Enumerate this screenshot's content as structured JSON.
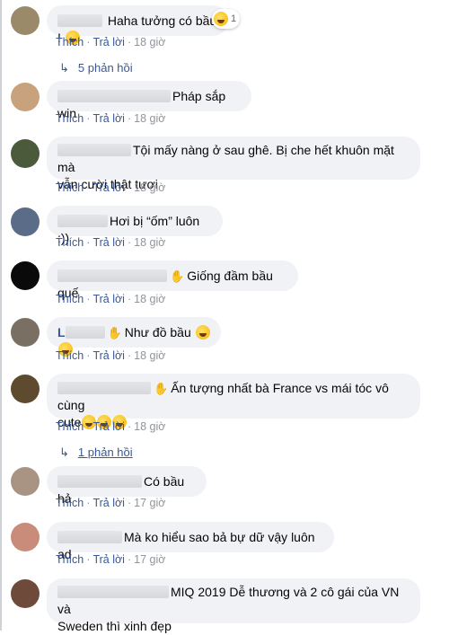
{
  "actions": {
    "like": "Thích",
    "reply": "Trả lời",
    "sep": "·"
  },
  "comments": [
    {
      "text": "Haha tưởng có bầu ! ",
      "time": "18 giờ",
      "reaction_count": "1",
      "replies": "5 phản hồi",
      "avatar_color": "#9b8a6a"
    },
    {
      "text": "Pháp sắp win",
      "time": "18 giờ",
      "avatar_color": "#c7a27c"
    },
    {
      "text": "Tội mấy nàng ở sau ghê. Bị che hết khuôn mặt mà",
      "text2": "vẫn cười thật tươi",
      "time": "18 giờ",
      "avatar_color": "#4a5a3a"
    },
    {
      "text": "Hơi bị “ốm” luôn :))",
      "time": "18 giờ",
      "avatar_color": "#5a6c88"
    },
    {
      "text": "Giống đầm bầu quế",
      "time": "18 giờ",
      "avatar_color": "#0a0a0a"
    },
    {
      "initial": "L",
      "text": "Như đồ bầu",
      "time": "18 giờ",
      "avatar_color": "#7a6f63"
    },
    {
      "text": "Ấn tượng nhất bà France vs mái tóc vô cùng",
      "text2": "cute",
      "time": "18 giờ",
      "replies": "1 phản hồi",
      "avatar_color": "#5e4a2e"
    },
    {
      "text": "Có bầu hả",
      "time": "17 giờ",
      "avatar_color": "#a99484"
    },
    {
      "text": "Mà ko hiểu sao bả bự dữ vậy luôn ad",
      "time": "17 giờ",
      "avatar_color": "#c98c7a"
    },
    {
      "text": "MIQ 2019 Dễ thương và 2 cô gái của VN và",
      "text2": "Sweden thì xinh đẹp",
      "avatar_color": "#6d4a3a"
    }
  ]
}
